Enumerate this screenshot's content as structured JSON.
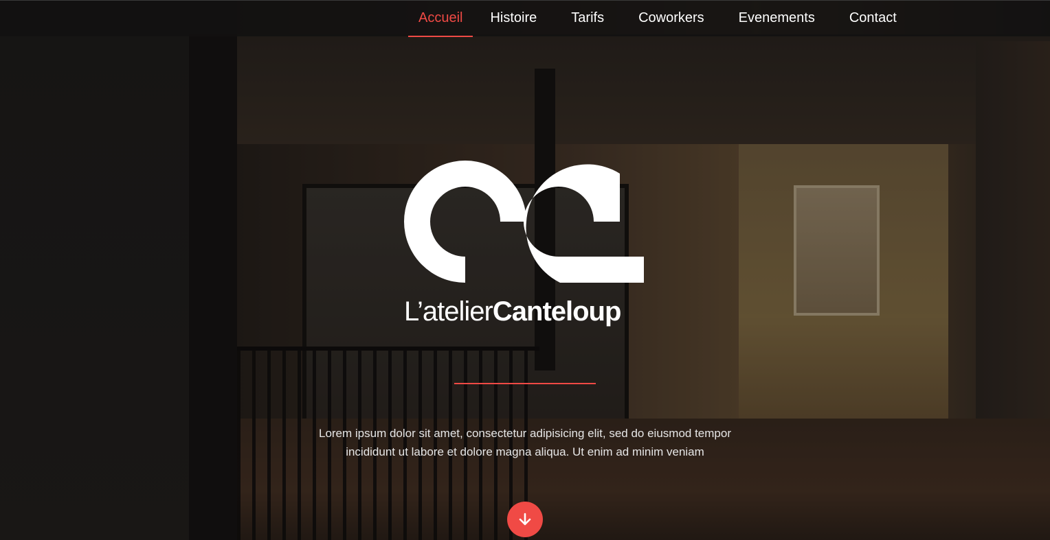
{
  "nav": {
    "items": [
      {
        "label": "Accueil",
        "active": true
      },
      {
        "label": "Histoire",
        "active": false
      },
      {
        "label": "Tarifs",
        "active": false
      },
      {
        "label": "Coworkers",
        "active": false
      },
      {
        "label": "Evenements",
        "active": false
      },
      {
        "label": "Contact",
        "active": false
      }
    ]
  },
  "hero": {
    "logo_text_light": "L’atelier",
    "logo_text_bold": "Canteloup",
    "intro_line1": "Lorem ipsum dolor sit amet, consectetur adipisicing elit, sed do eiusmod tempor",
    "intro_line2": "incididunt ut labore et dolore magna aliqua. Ut enim ad minim veniam",
    "scroll_icon": "arrow-down-icon"
  },
  "colors": {
    "accent": "#f04a45",
    "nav_background": "#121111",
    "text": "#ffffff"
  }
}
